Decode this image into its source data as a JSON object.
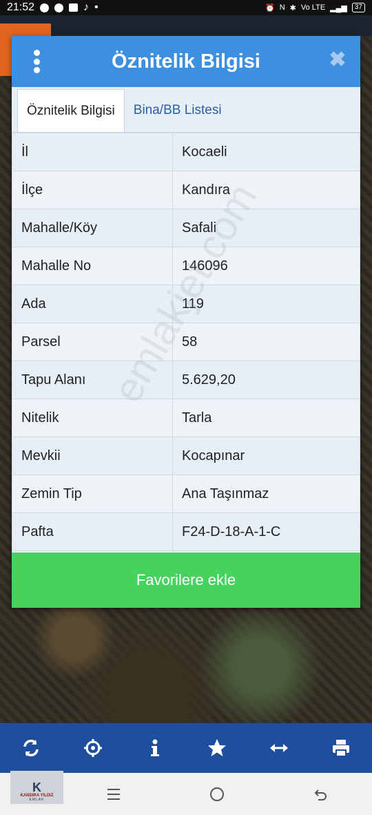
{
  "status_bar": {
    "time": "21:52",
    "battery": "37",
    "network": "Vo LTE"
  },
  "dialog": {
    "title": "Öznitelik Bilgisi",
    "tabs": [
      {
        "label": "Öznitelik Bilgisi",
        "active": true
      },
      {
        "label": "Bina/BB Listesi",
        "active": false
      }
    ],
    "rows": [
      {
        "key": "İl",
        "value": "Kocaeli"
      },
      {
        "key": "İlçe",
        "value": "Kandıra"
      },
      {
        "key": "Mahalle/Köy",
        "value": "Safali"
      },
      {
        "key": "Mahalle No",
        "value": "146096"
      },
      {
        "key": "Ada",
        "value": "119"
      },
      {
        "key": "Parsel",
        "value": "58"
      },
      {
        "key": "Tapu Alanı",
        "value": "5.629,20"
      },
      {
        "key": "Nitelik",
        "value": "Tarla"
      },
      {
        "key": "Mevkii",
        "value": "Kocapınar"
      },
      {
        "key": "Zemin Tip",
        "value": "Ana Taşınmaz"
      },
      {
        "key": "Pafta",
        "value": "F24-D-18-A-1-C"
      }
    ],
    "favorite_button": "Favorilere ekle",
    "colors": {
      "header": "#3d8fe0",
      "button": "#45d25e"
    }
  },
  "watermark": "emlakjet.com",
  "toolbar": {
    "icons": [
      "refresh-icon",
      "locate-icon",
      "info-icon",
      "star-icon",
      "measure-icon",
      "print-icon"
    ]
  },
  "logo": {
    "mark": "K",
    "line1": "KANDIRA YILDIZ",
    "line2": "EMLAK"
  }
}
